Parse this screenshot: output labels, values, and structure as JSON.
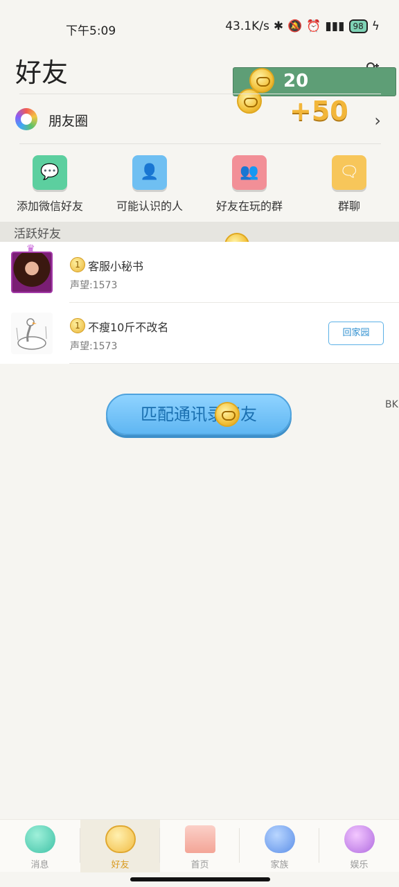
{
  "status_bar": {
    "time": "下午5:09",
    "net_speed": "43.1K/s",
    "battery": "98"
  },
  "header": {
    "title": "好友"
  },
  "reward": {
    "count": "20",
    "bonus": "+50"
  },
  "moments": {
    "label": "朋友圈"
  },
  "shortcuts": [
    {
      "label": "添加微信好友",
      "color": "#5ccf9f",
      "icon": "wechat-icon"
    },
    {
      "label": "可能认识的人",
      "color": "#6fbff2",
      "icon": "person-icon"
    },
    {
      "label": "好友在玩的群",
      "color": "#f28f97",
      "icon": "people-icon"
    },
    {
      "label": "群聊",
      "color": "#f7c65a",
      "icon": "chat-icon"
    }
  ],
  "section": {
    "title": "活跃好友"
  },
  "friends": [
    {
      "name": "客服小秘书",
      "reputation": "声望:1573"
    },
    {
      "name": "不瘦10斤不改名",
      "reputation": "声望:1573",
      "action": "回家园"
    }
  ],
  "match_button": {
    "label": "匹配通讯录好友"
  },
  "side_tag": {
    "text": "BK"
  },
  "tabs": [
    {
      "label": "消息",
      "active": false
    },
    {
      "label": "好友",
      "active": true
    },
    {
      "label": "首页",
      "active": false
    },
    {
      "label": "家族",
      "active": false
    },
    {
      "label": "娱乐",
      "active": false
    }
  ],
  "colors": {
    "accent": "#d99b20",
    "reward_bg": "#5e9e76",
    "match_button": "#6fc0f6"
  }
}
